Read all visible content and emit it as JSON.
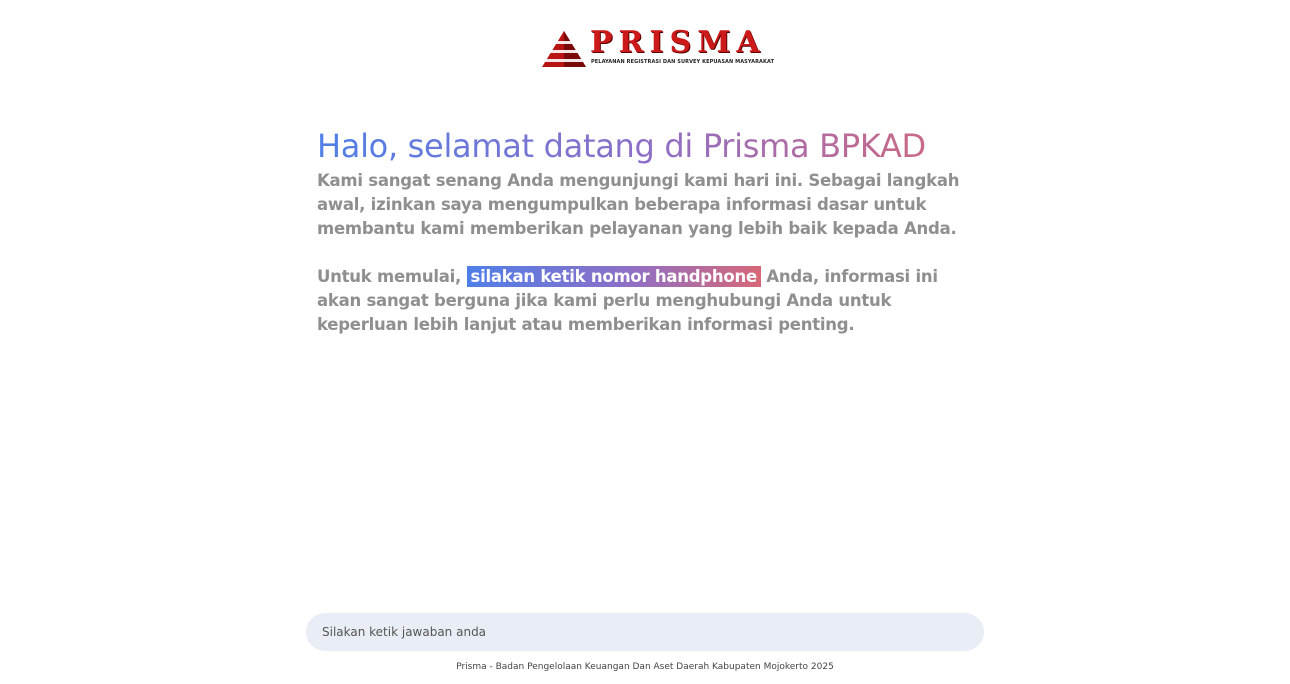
{
  "brand": {
    "logo_word": "PRISMA",
    "logo_tagline": "PELAYANAN REGISTRASI DAN SURVEY KEPUASAN MASYARAKAT",
    "logo_icon": "pyramid-logo-icon",
    "brand_color": "#cc1a1a"
  },
  "main": {
    "headline": "Halo, selamat datang di Prisma BPKAD",
    "paragraph_1": "Kami sangat senang Anda mengunjungi kami hari ini. Sebagai langkah awal, izinkan saya mengumpulkan beberapa informasi dasar untuk membantu kami memberikan pelayanan yang lebih baik kepada Anda.",
    "paragraph_2_prefix": "Untuk memulai, ",
    "paragraph_2_highlight": "silakan ketik nomor handphone",
    "paragraph_2_suffix": " Anda, informasi ini akan sangat berguna jika kami perlu menghubungi Anda untuk keperluan lebih lanjut atau memberikan informasi penting."
  },
  "input": {
    "placeholder": "Silakan ketik jawaban anda",
    "value": ""
  },
  "footer": {
    "text": "Prisma - Badan Pengelolaan Keuangan Dan Aset Daerah Kabupaten Mojokerto 2025"
  },
  "colors": {
    "gradient_start": "#4f7fe8",
    "gradient_mid": "#8e6fc6",
    "gradient_end": "#d76878",
    "body_text": "#8f8f8f",
    "input_bg": "#e9edf5"
  }
}
